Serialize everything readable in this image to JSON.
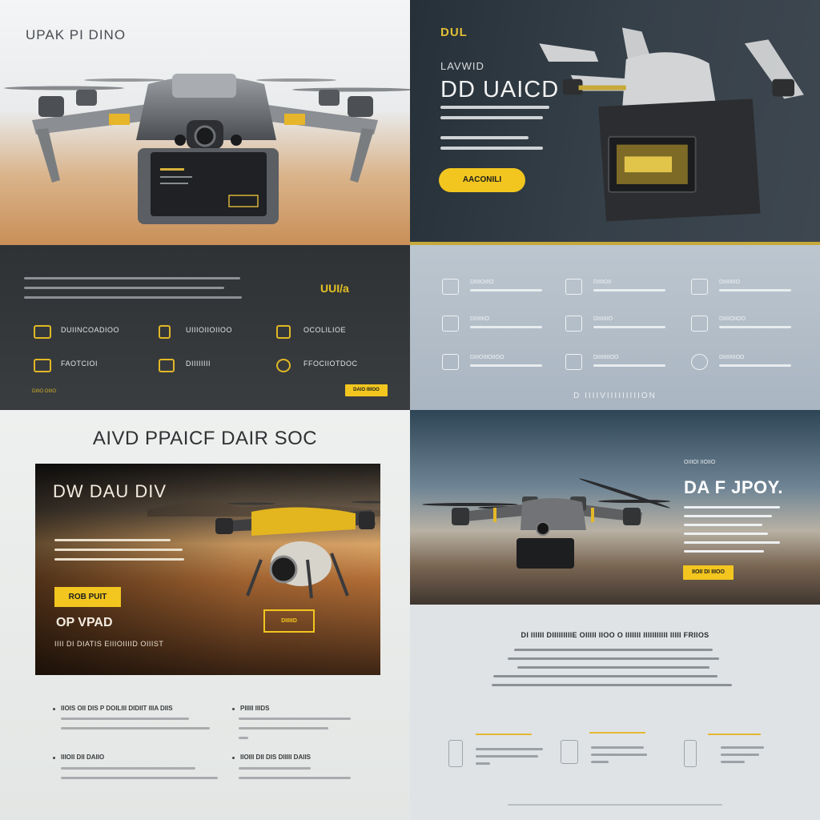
{
  "panel1": {
    "brand": "UPAK PI DINO"
  },
  "panel2": {
    "logo": "DUL",
    "eyebrow": "LAVWID",
    "headline": "DD UAICD",
    "cta": "AACONILI"
  },
  "panel3": {
    "yellow_title": "UUI/a",
    "features": [
      {
        "icon": "screen-icon",
        "label": "DUIINCOADIOO"
      },
      {
        "icon": "phone-icon",
        "label": "UIIIOIIOIIOO"
      },
      {
        "icon": "battery-icon",
        "label": "OCOLILIOE"
      },
      {
        "icon": "grid-icon",
        "label": "FAOTCIOI"
      },
      {
        "icon": "monitor-icon",
        "label": "DIIIIIIII"
      },
      {
        "icon": "speed-icon",
        "label": "FFOCIIOTDOC"
      }
    ],
    "tiny": "DIIIO OIIIO",
    "cta": "DAIO IIIIOO"
  },
  "panel4": {
    "features": [
      {
        "icon": "screen-icon",
        "label": "DIIIIOIIIO"
      },
      {
        "icon": "controller-icon",
        "label": "DIIIIOII"
      },
      {
        "icon": "signal-icon",
        "label": "DIIIIIIIIO"
      },
      {
        "icon": "battery-icon",
        "label": "DIIIIIIIO"
      },
      {
        "icon": "monitor-icon",
        "label": "DIIIIIIIO"
      },
      {
        "icon": "phone-icon",
        "label": "DIIIIOIIOO"
      },
      {
        "icon": "settings-icon",
        "label": "DIIIOIIIOIIOO"
      },
      {
        "icon": "grid-icon",
        "label": "DIIIIIIIIOO"
      },
      {
        "icon": "camera-icon",
        "label": "DIIIIIIIIOO"
      }
    ],
    "footer": "D IIIIVIIIIIIIIION"
  },
  "panel5": {
    "title": "AIVD PPAICF DAIR SOC",
    "hero_title": "DW DAU DIV",
    "btn_primary": "ROB PUIT",
    "sub_title": "OP VPAD",
    "sub_line": "IIII DI DIATIS EIIIOIIIID OIIIST",
    "btn_outline": "DIIIIID",
    "items": [
      {
        "title": "IIOIS OII DIS P DOILIII DIDIIT IIIA DIIS"
      },
      {
        "title": "PIIIII IIIDS"
      },
      {
        "title": "IIIOII DII DAIIO"
      },
      {
        "title": "IIOIII DII DIS DIIIII DAIIS"
      }
    ]
  },
  "panel6": {
    "eyebrow": "OIIIOI IIOIIO",
    "title": "DA F JPOY.",
    "cta": "IIOII DI IIIOO",
    "section_title": "DI IIIIII DIIIIIIIIIE OIIIII IIOO O IIIIIII IIIIIIIIIII IIIII FRIIOS"
  },
  "colors": {
    "accent_yellow": "#f2c61f",
    "dark_panel": "#2f3235",
    "slate_panel": "#b3bec9"
  }
}
